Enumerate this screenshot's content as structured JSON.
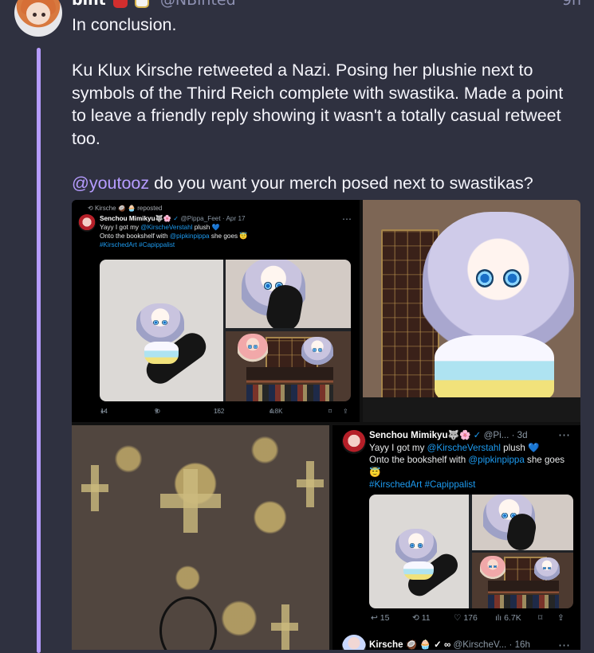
{
  "post": {
    "display_name": "bint",
    "handle": "@NBinted",
    "time": "9h",
    "paragraphs": [
      "In conclusion.",
      "Ku Klux Kirsche retweeted a Nazi. Posing her plushie next to symbols of the Third Reich complete with swastika. Made a point to leave a friendly reply showing it wasn't a totally casual retweet too."
    ],
    "mention": "@youtooz",
    "mention_text": " do you want your merch posed next to swastikas?"
  },
  "embedded_tweet_small": {
    "reposted_by": "Kirsche 🥥 🧁 reposted",
    "author": "Senchou Mimikyu🐺🌸",
    "handle": "@Pippa_Feet · Apr 17",
    "text_before": "Yayy I got my ",
    "mention_1": "@KirscheVerstahl",
    "text_after": " plush 💙",
    "line2_before": "Onto the bookshelf with ",
    "mention_2": "@pipkinpippa",
    "line2_after": " she goes 😇",
    "hashtags": "#KirschedArt #Capippalist",
    "replies": "14",
    "retweets": "9",
    "likes": "162",
    "views": "4.8K"
  },
  "embedded_tweet_large": {
    "author": "Senchou Mimikyu🐺🌸",
    "handle": "@Pi... · 3d",
    "text_before": "Yayy I got my ",
    "mention_1": "@KirscheVerstahl",
    "text_after": " plush 💙",
    "line2_before": "Onto the bookshelf with ",
    "mention_2": "@pipkinpippa",
    "line2_after": " she goes 😇",
    "hashtags": "#KirschedArt #Capippalist",
    "replies": "15",
    "retweets": "11",
    "likes": "176",
    "views": "6.7K",
    "reply_author": "Kirsche 🥥 🧁 ✓ ∞",
    "reply_handle": "@KirscheV... · 16h"
  },
  "icons": {
    "reply": "↩",
    "retweet": "⟲",
    "like": "♡",
    "views": "ılı",
    "bookmark": "⌑",
    "share": "⇪",
    "more": "⋯",
    "verified": "✓"
  },
  "colors": {
    "background": "#2f3140",
    "thread_line": "#b69cff",
    "mention": "#b69cff",
    "tweet_link": "#1d9bf0"
  }
}
